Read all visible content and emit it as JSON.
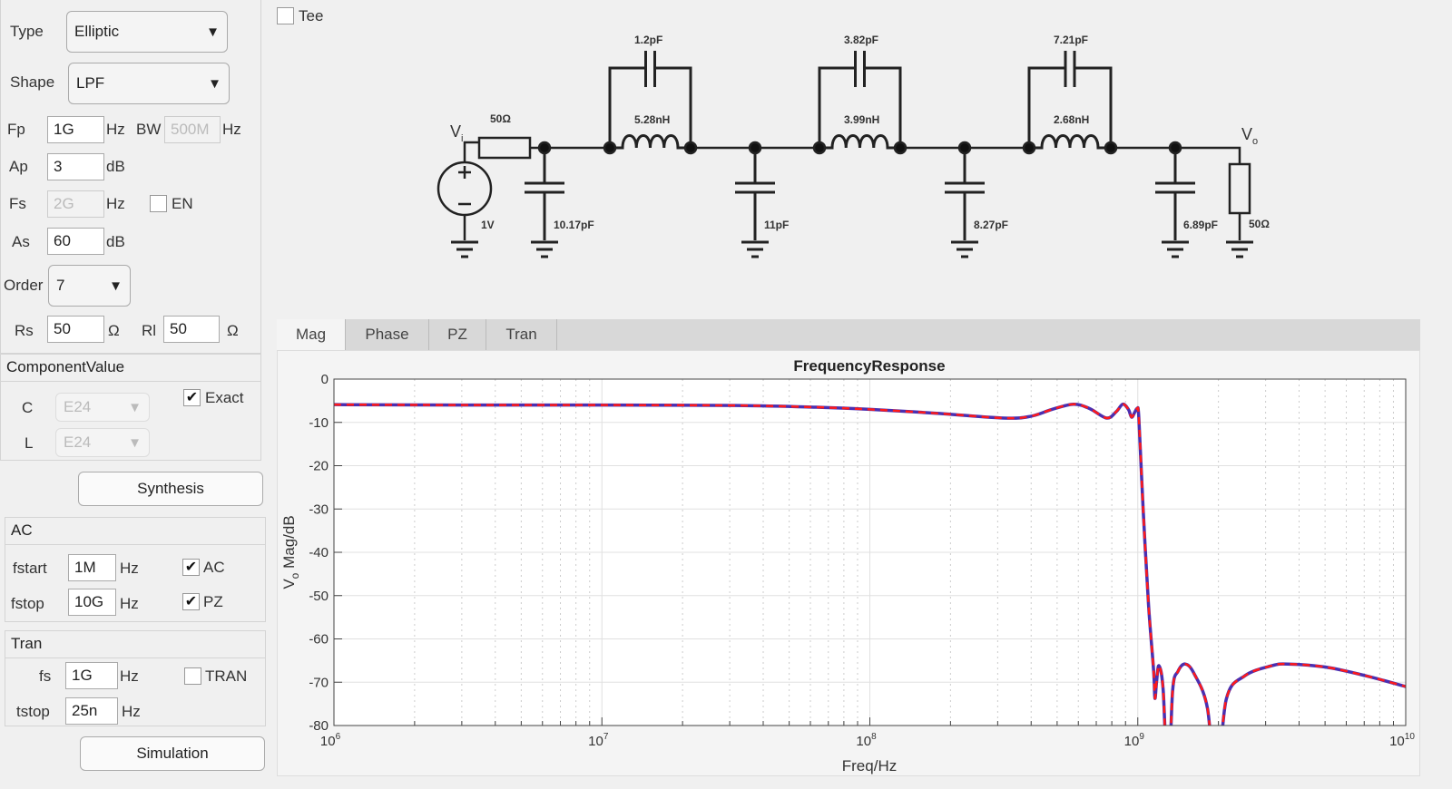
{
  "design": {
    "type_label": "Type",
    "type_value": "Elliptic",
    "shape_label": "Shape",
    "shape_value": "LPF",
    "fp_label": "Fp",
    "fp_value": "1G",
    "fp_unit": "Hz",
    "bw_label": "BW",
    "bw_value": "500M",
    "bw_unit": "Hz",
    "ap_label": "Ap",
    "ap_value": "3",
    "ap_unit": "dB",
    "fs_label": "Fs",
    "fs_value": "2G",
    "fs_unit": "Hz",
    "en_label": "EN",
    "en_checked": false,
    "as_label": "As",
    "as_value": "60",
    "as_unit": "dB",
    "order_label": "Order",
    "order_value": "7",
    "rs_label": "Rs",
    "rs_value": "50",
    "rs_unit": "Ω",
    "rl_label": "Rl",
    "rl_value": "50",
    "rl_unit": "Ω"
  },
  "component_value": {
    "title": "ComponentValue",
    "c_label": "C",
    "c_value": "E24",
    "l_label": "L",
    "l_value": "E24",
    "exact_label": "Exact",
    "exact_checked": true
  },
  "synthesis_button": "Synthesis",
  "ac": {
    "title": "AC",
    "fstart_label": "fstart",
    "fstart_value": "1M",
    "fstart_unit": "Hz",
    "fstop_label": "fstop",
    "fstop_value": "10G",
    "fstop_unit": "Hz",
    "ac_label": "AC",
    "ac_checked": true,
    "pz_label": "PZ",
    "pz_checked": true
  },
  "tran": {
    "title": "Tran",
    "fs_label": "fs",
    "fs_value": "1G",
    "fs_unit": "Hz",
    "tstop_label": "tstop",
    "tstop_value": "25n",
    "tstop_unit": "Hz",
    "tran_label": "TRAN",
    "tran_checked": false
  },
  "simulation_button": "Simulation",
  "tee": {
    "label": "Tee",
    "checked": false
  },
  "circuit": {
    "vi": "V",
    "vi_sub": "i",
    "vo": "V",
    "vo_sub": "o",
    "source": "1V",
    "rs": "50Ω",
    "rl": "50Ω",
    "shunt_caps": [
      "10.17pF",
      "11pF",
      "8.27pF",
      "6.89pF"
    ],
    "series_caps": [
      "1.2pF",
      "3.82pF",
      "7.21pF"
    ],
    "inductors": [
      "5.28nH",
      "3.99nH",
      "2.68nH"
    ]
  },
  "tabs": [
    {
      "label": "Mag",
      "active": true
    },
    {
      "label": "Phase",
      "active": false
    },
    {
      "label": "PZ",
      "active": false
    },
    {
      "label": "Tran",
      "active": false
    }
  ],
  "chart_data": {
    "type": "line",
    "title": "FrequencyResponse",
    "xlabel": "Freq/Hz",
    "ylabel": "V_o Mag/dB",
    "ylabel_main": "V",
    "ylabel_sub": "o",
    "ylabel_rest": " Mag/dB",
    "xscale": "log",
    "xlim": [
      1000000,
      10000000000
    ],
    "ylim": [
      -80,
      0
    ],
    "xticks": [
      {
        "base": "10",
        "exp": "6"
      },
      {
        "base": "10",
        "exp": "7"
      },
      {
        "base": "10",
        "exp": "8"
      },
      {
        "base": "10",
        "exp": "9"
      },
      {
        "base": "10",
        "exp": "10"
      }
    ],
    "yticks": [
      "0",
      "-10",
      "-20",
      "-30",
      "-40",
      "-50",
      "-60",
      "-70",
      "-80"
    ],
    "grid": true,
    "colors": {
      "solid": "#4b2fb0",
      "dashed": "#ff1a1a"
    },
    "series": [
      {
        "style": "solid blue with red dashed overlay",
        "log10_freq": [
          6,
          6.5,
          7,
          7.5,
          7.8,
          8,
          8.25,
          8.5,
          8.6,
          8.68,
          8.76,
          8.82,
          8.884,
          8.92,
          8.944,
          8.965,
          8.977,
          8.99,
          8.998,
          9.004,
          9.02,
          9.04,
          9.059,
          9.064,
          9.07,
          9.079,
          9.095,
          9.113,
          9.13,
          9.15,
          9.177,
          9.21,
          9.26,
          9.293,
          9.33,
          9.4,
          9.5,
          9.56,
          9.7,
          9.85,
          10
        ],
        "mag_db": [
          -5.9,
          -6,
          -6,
          -6.1,
          -6.5,
          -7,
          -7.9,
          -9,
          -8.6,
          -7,
          -5.8,
          -6.8,
          -9,
          -7.5,
          -5.8,
          -7,
          -8.8,
          -7.5,
          -6.9,
          -9,
          -30,
          -52,
          -67.2,
          -73.7,
          -70,
          -66.2,
          -72,
          -95,
          -72,
          -67.5,
          -65.8,
          -68,
          -76,
          -95,
          -74,
          -68.5,
          -66.2,
          -65.8,
          -66.5,
          -68.5,
          -71
        ]
      }
    ]
  }
}
